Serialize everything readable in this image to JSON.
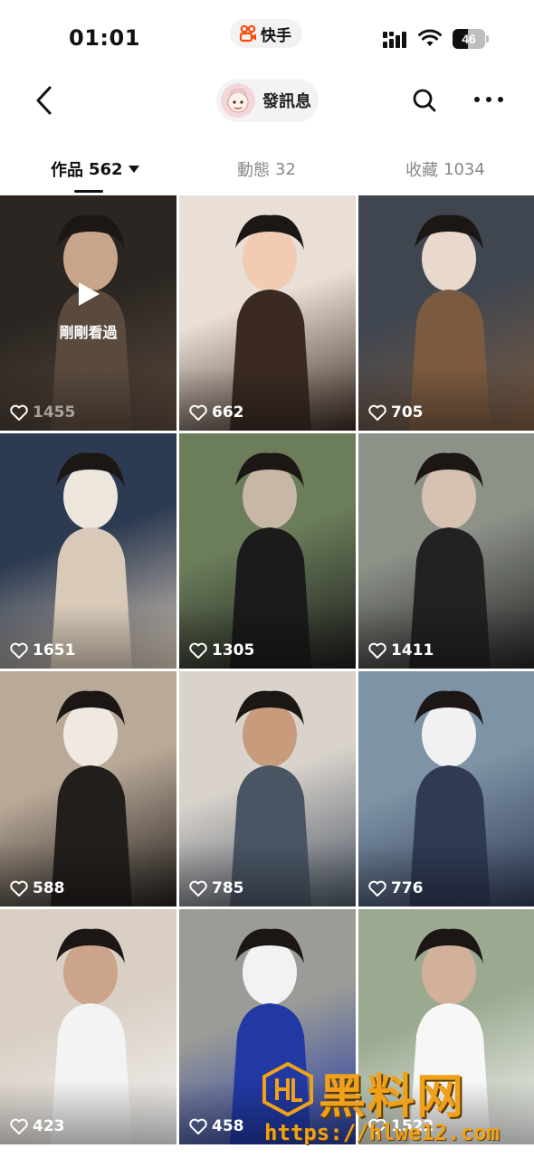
{
  "status_bar": {
    "time": "01:01",
    "app_name": "快手",
    "battery_level": "46",
    "battery_fraction": 0.46
  },
  "nav": {
    "message_label": "發訊息",
    "back_icon": "chevron-left-icon",
    "search_icon": "search-icon",
    "more_icon": "more-icon"
  },
  "tabs": [
    {
      "label": "作品",
      "count": "562",
      "active": true
    },
    {
      "label": "動態",
      "count": "32",
      "active": false
    },
    {
      "label": "收藏",
      "count": "1034",
      "active": false
    }
  ],
  "videos": [
    {
      "likes": "1455",
      "watched_label": "剛剛看過",
      "colors": [
        "#2b2622",
        "#5a4a3e",
        "#c8a58a"
      ]
    },
    {
      "likes": "662",
      "colors": [
        "#e9dfd6",
        "#3a2a22",
        "#f2cbb3"
      ]
    },
    {
      "likes": "705",
      "colors": [
        "#3f4650",
        "#7a5a40",
        "#e8d9cc"
      ]
    },
    {
      "likes": "1651",
      "colors": [
        "#2d3b52",
        "#d8c9b8",
        "#ede6dc"
      ]
    },
    {
      "likes": "1305",
      "colors": [
        "#6b7d5a",
        "#1b1b1b",
        "#c7b7a6"
      ]
    },
    {
      "likes": "1411",
      "colors": [
        "#8d9289",
        "#222222",
        "#d7c1b0"
      ]
    },
    {
      "likes": "588",
      "colors": [
        "#b9a998",
        "#221e1c",
        "#efe9e2"
      ]
    },
    {
      "likes": "785",
      "colors": [
        "#d9d3cc",
        "#4a5564",
        "#c79b7c"
      ]
    },
    {
      "likes": "776",
      "colors": [
        "#7e93a6",
        "#303a55",
        "#f1f1f1"
      ]
    },
    {
      "likes": "423",
      "colors": [
        "#d9cfc4",
        "#f3f3f3",
        "#cba48a"
      ]
    },
    {
      "likes": "458",
      "colors": [
        "#9b9c97",
        "#2239a4",
        "#f2f2f2"
      ]
    },
    {
      "likes": "1522",
      "colors": [
        "#9aa98f",
        "#f7f7f7",
        "#d2b09a"
      ]
    }
  ],
  "watermark": {
    "brand": "黑料网",
    "url": "https://hlwe12.com"
  },
  "accent": "#f0a11a"
}
